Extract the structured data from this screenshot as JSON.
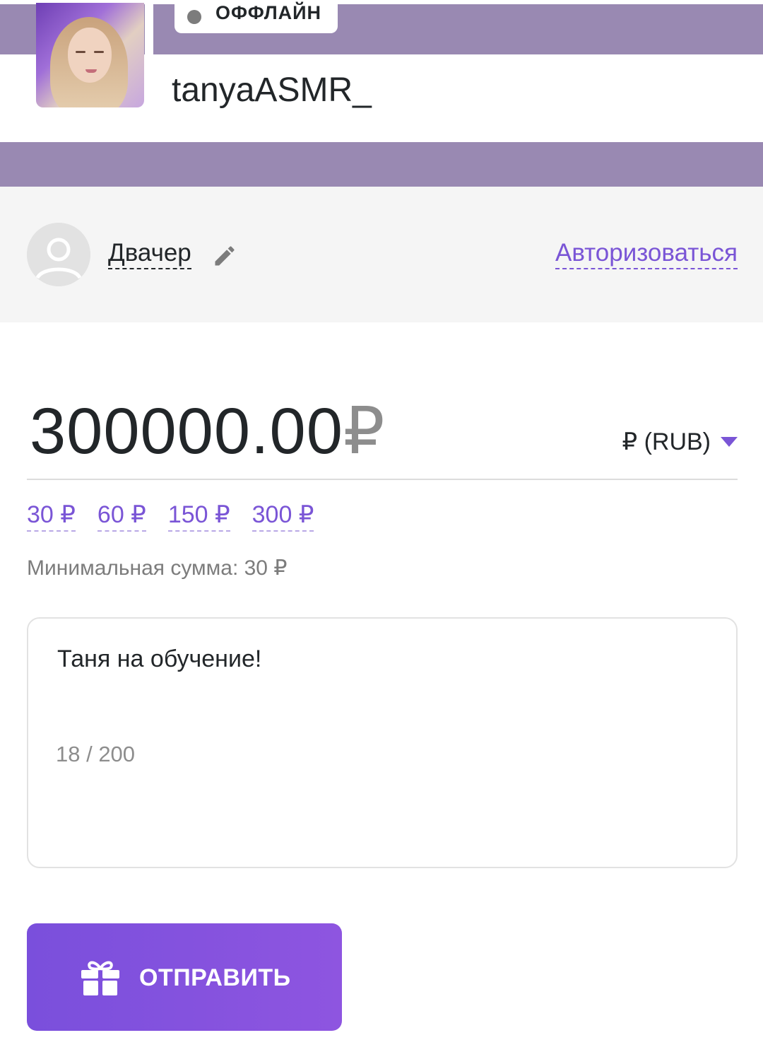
{
  "streamer": {
    "status": "ОФФЛАЙН",
    "name": "tanyaASMR_"
  },
  "sender": {
    "name": "Двачер",
    "auth_link": "Авторизоваться"
  },
  "donation": {
    "amount": "300000.00",
    "currency_symbol": "₽",
    "currency_select": "₽ (RUB)",
    "presets": [
      "30 ₽",
      "60 ₽",
      "150 ₽",
      "300 ₽"
    ],
    "min_sum": "Минимальная сумма: 30 ₽"
  },
  "message": {
    "text": "Таня на обучение!",
    "counter": "18 / 200"
  },
  "send_button": {
    "label": "ОТПРАВИТЬ"
  },
  "colors": {
    "accent": "#7a55d6",
    "banner": "#9989b2",
    "status_dot": "#7c7c7c"
  },
  "icons": [
    "user-avatar-icon",
    "pencil-icon",
    "caret-down-icon",
    "gift-icon"
  ]
}
